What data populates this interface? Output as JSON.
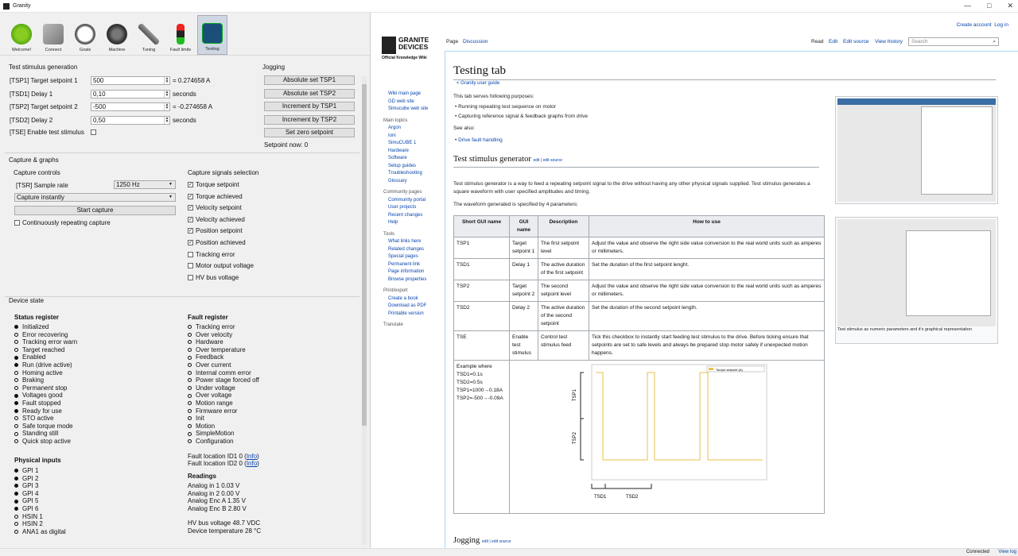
{
  "window": {
    "title": "Granity"
  },
  "toolbar": [
    {
      "label": "Welcome!"
    },
    {
      "label": "Connect"
    },
    {
      "label": "Goals"
    },
    {
      "label": "Machine"
    },
    {
      "label": "Tuning"
    },
    {
      "label": "Fault limits"
    },
    {
      "label": "Testing"
    }
  ],
  "stim": {
    "title": "Test stimulus generation",
    "tsp1_label": "[TSP1] Target setpoint 1",
    "tsp1_value": "500",
    "tsp1_conv": "= 0.274658 A",
    "tsd1_label": "[TSD1] Delay 1",
    "tsd1_value": "0,10",
    "tsd1_unit": "seconds",
    "tsp2_label": "[TSP2] Target setpoint 2",
    "tsp2_value": "-500",
    "tsp2_conv": "= -0.274658 A",
    "tsd2_label": "[TSD2] Delay 2",
    "tsd2_value": "0,50",
    "tsd2_unit": "seconds",
    "tse_label": "[TSE] Enable test stimulus"
  },
  "jog": {
    "title": "Jogging",
    "b1": "Absolute set TSP1",
    "b2": "Absolute set TSP2",
    "b3": "Increment by TSP1",
    "b4": "Increment by TSP2",
    "b5": "Set zero setpoint",
    "now": "Setpoint now: 0"
  },
  "capture": {
    "title": "Capture & graphs",
    "controls": "Capture controls",
    "tsr_label": "[TSR] Sample rate",
    "tsr_value": "1250 Hz",
    "mode": "Capture instantly",
    "start": "Start capture",
    "cont": "Continuously repeating capture",
    "signals_title": "Capture signals selection",
    "signals": [
      {
        "label": "Torque setpoint",
        "on": true
      },
      {
        "label": "Torque achieved",
        "on": true
      },
      {
        "label": "Velocity setpoint",
        "on": true
      },
      {
        "label": "Velocity achieved",
        "on": true
      },
      {
        "label": "Position setpoint",
        "on": true
      },
      {
        "label": "Position achieved",
        "on": true
      },
      {
        "label": "Tracking error",
        "on": false
      },
      {
        "label": "Motor output voltage",
        "on": false
      },
      {
        "label": "HV bus voltage",
        "on": false
      }
    ]
  },
  "device": {
    "title": "Device state",
    "status_title": "Status register",
    "status": [
      {
        "t": "Initialized",
        "f": true
      },
      {
        "t": "Error recovering",
        "f": false
      },
      {
        "t": "Tracking error warn",
        "f": false
      },
      {
        "t": "Target reached",
        "f": false
      },
      {
        "t": "Enabled",
        "f": true
      },
      {
        "t": "Run (drive active)",
        "f": true
      },
      {
        "t": "Homing active",
        "f": false
      },
      {
        "t": "Braking",
        "f": false
      },
      {
        "t": "Permanent stop",
        "f": false
      },
      {
        "t": "Voltages good",
        "f": true
      },
      {
        "t": "Fault stopped",
        "f": true
      },
      {
        "t": "Ready for use",
        "f": true
      },
      {
        "t": "STO active",
        "f": false
      },
      {
        "t": "Safe torque mode",
        "f": false
      },
      {
        "t": "Standing still",
        "f": false
      },
      {
        "t": "Quick stop active",
        "f": false
      }
    ],
    "fault_title": "Fault register",
    "faults": [
      "Tracking error",
      "Over velocity",
      "Hardware",
      "Over temperature",
      "Feedback",
      "Over current",
      "Internal comm error",
      "Power stage forced off",
      "Under voltage",
      "Over voltage",
      "Motion range",
      "Firmware error",
      "Init",
      "Motion",
      "SimpleMotion",
      "Configuration"
    ],
    "inputs_title": "Physical inputs",
    "inputs": [
      {
        "t": "GPI 1",
        "f": true
      },
      {
        "t": "GPI 2",
        "f": true
      },
      {
        "t": "GPI 3",
        "f": true
      },
      {
        "t": "GPI 4",
        "f": true
      },
      {
        "t": "GPI 5",
        "f": true
      },
      {
        "t": "GPI 6",
        "f": true
      },
      {
        "t": "HSIN 1",
        "f": false
      },
      {
        "t": "HSIN 2",
        "f": false
      },
      {
        "t": "ANA1 as digital",
        "f": false
      }
    ],
    "loc1": "Fault location ID1 0 (",
    "loc1_link": "Info",
    "loc2": "Fault location ID2 0 (",
    "loc2_link": "Info",
    "readings_title": "Readings",
    "readings": [
      "Analog in 1  0.03 V",
      "Analog in 2  0.00 V",
      "Analog Enc A  1.35 V",
      "Analog Enc B  2.80 V"
    ],
    "hv": "HV bus voltage  48.7 VDC",
    "temp": "Device temperature  28 °C"
  },
  "wiki": {
    "logo1": "GRANITE",
    "logo2": "DEVICES",
    "logo3": "Official Knowledge Wiki",
    "create": "Create account",
    "login": "Log in",
    "page": "Page",
    "discussion": "Discussion",
    "read": "Read",
    "edit": "Edit",
    "editsrc": "Edit source",
    "history": "View history",
    "search": "Search",
    "nav1": [
      "Wiki main page",
      "GD web site",
      "Simucube web site"
    ],
    "main_topics": "Main topics",
    "nav2": [
      "Argon",
      "Ioni",
      "SimuCUBE 1",
      "Hardware",
      "Software",
      "Setup guides",
      "Troubleshooting",
      "Glossary"
    ],
    "community": "Community pages",
    "nav3": [
      "Community portal",
      "User projects",
      "Recent changes",
      "Help"
    ],
    "tools": "Tools",
    "nav4": [
      "What links here",
      "Related changes",
      "Special pages",
      "Permanent link",
      "Page information",
      "Browse properties"
    ],
    "print": "Print/export",
    "nav5": [
      "Create a book",
      "Download as PDF",
      "Printable version"
    ],
    "translate": "Translate",
    "title": "Testing tab",
    "breadcrumb": "< Granity user guide",
    "intro": "This tab serves following purposes:",
    "p1": "Running repeating test sequence on motor",
    "p2": "Capturing reference signal & feedback graphs from drive",
    "seealso": "See also:",
    "p3": "Drive fault handling",
    "h_stim": "Test stimulus generator",
    "editlinks": "edit | edit source",
    "stim_text": "Test stimulus generator is a way to feed a repeating setpoint signal to the drive without having any other physical signals supplied. Test stimulus generates a square waveform with user specified amplitudes and timing.",
    "stim_text2": "The waveform generated is specified by 4 parameters:",
    "th": [
      "Short GUI name",
      "GUI name",
      "Description",
      "How to use"
    ],
    "rows": [
      [
        "TSP1",
        "Target setpoint 1",
        "The first setpoint level",
        "Adjust the value and observe the right side value conversion to the real world units such as amperes or millimeters."
      ],
      [
        "TSD1",
        "Delay 1",
        "The active duration of the first setpoint",
        "Set the duration of the first setpoint lenght."
      ],
      [
        "TSP2",
        "Target setpoint 2",
        "The second setpoint level",
        "Adjust the value and observe the right side value conversion to the real world units such as amperes or millimeters."
      ],
      [
        "TSD2",
        "Delay 2",
        "The active duration of the second setpoint",
        "Set the duration of the second setpoint length."
      ],
      [
        "TSE",
        "Enable test stimulus",
        "Control test stimulus feed",
        "Tick this checkbox to instantly start feeding test stimulus to the drive. Before ticking ensure that setpoints are set to safe levels and always be prepared stop motor safely if unexpected motion happens."
      ]
    ],
    "example": [
      "Example where",
      "TSD1=0.1s",
      "TSD2=0.5s",
      "TSP1=1000→0.18A",
      "TSP2=-500→-0.09A"
    ],
    "caption1": "Test stimulus as numeric parameters and it's graphical representation",
    "h_jog": "Jogging",
    "legend": "Torque setpoint (A)",
    "tsp1": "TSP1",
    "tsp2": "TSP2",
    "tsd1": "TSD1",
    "tsd2": "TSD2"
  },
  "status_bar": {
    "connected": "Connected",
    "log": "View log"
  }
}
